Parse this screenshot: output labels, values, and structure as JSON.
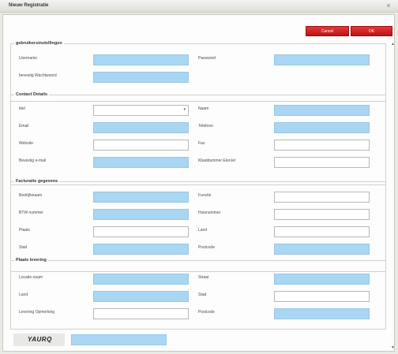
{
  "window": {
    "title": "Nieuw Registratie",
    "close_glyph": "×"
  },
  "buttons": {
    "cancel": "Cancel",
    "ok": "OK"
  },
  "sections": {
    "user": {
      "title": "gebruikersinstellingen",
      "username": "Username",
      "password": "Password",
      "confirm_password": "bevestig Wachtwoord"
    },
    "contact": {
      "title": "Contact Details",
      "title_label": "titel",
      "name": "Naam",
      "email": "Email",
      "phone": "Telefoon",
      "website": "Website",
      "fax": "Fax",
      "confirm_email": "Bevestig e-mail",
      "kvk": "Kbaddummer Eten/el"
    },
    "billing": {
      "title": "Facturatie gegevens",
      "company": "Bedrijfsnaam",
      "function": "Functie",
      "vat": "BTW nummer",
      "house_number": "Huisnummer",
      "place": "Plaats",
      "country": "Land",
      "city": "Stad",
      "postcode": "Postcode"
    },
    "delivery": {
      "title": "Plaats levering",
      "location_name": "Locatie naam",
      "street": "Straat",
      "country": "Land",
      "city": "Stad",
      "delivery_note": "Levering Opmerking",
      "postcode": "Postcode"
    }
  },
  "captcha": {
    "text": "YAURQ"
  },
  "colors": {
    "required_field": "#a9d6f2",
    "button": "#cc2020"
  }
}
